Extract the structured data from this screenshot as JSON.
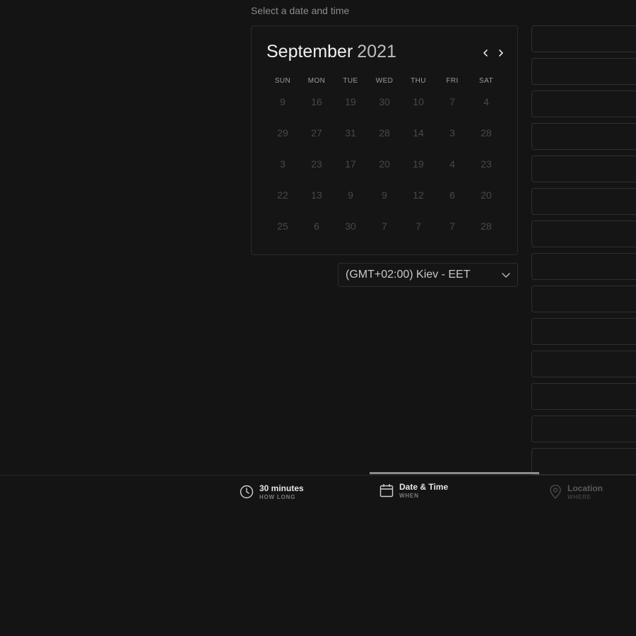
{
  "header": {
    "subtitle": "Select a date and time"
  },
  "calendar": {
    "month": "September",
    "year": "2021",
    "weekdays": [
      "SUN",
      "MON",
      "TUE",
      "WED",
      "THU",
      "FRI",
      "SAT"
    ],
    "weeks": [
      [
        "9",
        "16",
        "19",
        "30",
        "10",
        "7",
        "4"
      ],
      [
        "29",
        "27",
        "31",
        "28",
        "14",
        "3",
        "28"
      ],
      [
        "3",
        "23",
        "17",
        "20",
        "19",
        "4",
        "23"
      ],
      [
        "22",
        "13",
        "9",
        "9",
        "12",
        "6",
        "20"
      ],
      [
        "25",
        "6",
        "30",
        "7",
        "7",
        "7",
        "28"
      ]
    ]
  },
  "timezone": {
    "selected": "(GMT+02:00) Kiev - EET"
  },
  "time_slots_count_visible": 14,
  "steps": [
    {
      "label": "30 minutes",
      "sublabel": "HOW LONG",
      "icon": "clock-icon"
    },
    {
      "label": "Date & Time",
      "sublabel": "WHEN",
      "icon": "calendar-icon"
    },
    {
      "label": "Location",
      "sublabel": "WHERE",
      "icon": "location-pin-icon"
    }
  ],
  "colors": {
    "background": "#141414",
    "active_step_bar": "#8c8c8c"
  }
}
